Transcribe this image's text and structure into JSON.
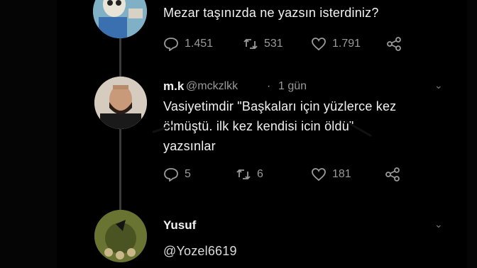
{
  "tweet1": {
    "text": "Mezar taşınızda ne yazsın isterdiniz?",
    "replies": "1.451",
    "retweets": "531",
    "likes": "1.791"
  },
  "tweet2": {
    "name": "m.k",
    "handle": "@mckzlkk",
    "sep": "·",
    "time": "1 gün",
    "line1": "Vasiyetimdir \"Başkaları için yüzlerce kez",
    "line2": "ölmüştü. ilk kez kendisi icin öldü\"",
    "line3": "yazsınlar",
    "replies": "5",
    "retweets": "6",
    "likes": "181"
  },
  "tweet3": {
    "name": "Yusuf",
    "handle": "@Yozel6619"
  },
  "icons": [
    "reply-icon",
    "retweet-icon",
    "like-icon",
    "share-icon",
    "chevron-down-icon"
  ]
}
